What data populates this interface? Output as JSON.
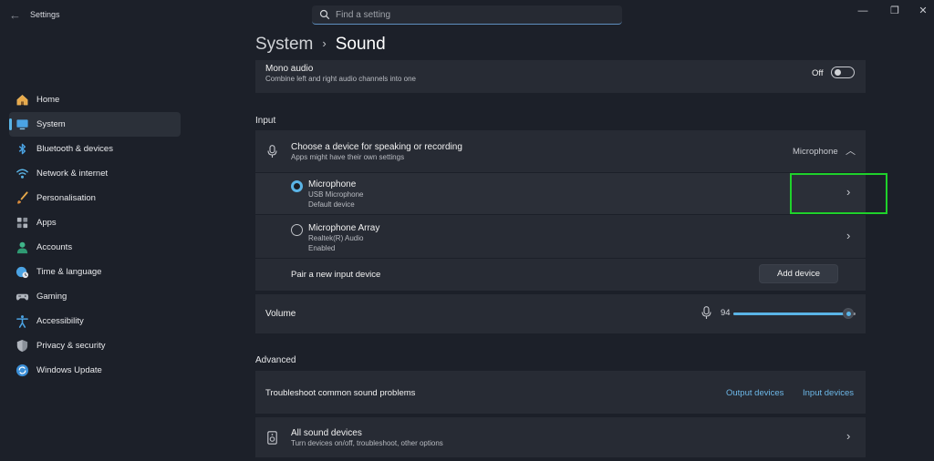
{
  "window": {
    "title": "Settings",
    "controls": {
      "minimize": "—",
      "restore": "❐",
      "close": "✕"
    }
  },
  "search": {
    "placeholder": "Find a setting"
  },
  "breadcrumb": {
    "parent": "System",
    "separator": "›",
    "current": "Sound"
  },
  "sidebar": {
    "items": [
      {
        "label": "Home",
        "icon": "home-icon"
      },
      {
        "label": "System",
        "icon": "system-icon",
        "active": true
      },
      {
        "label": "Bluetooth & devices",
        "icon": "bluetooth-icon"
      },
      {
        "label": "Network & internet",
        "icon": "wifi-icon"
      },
      {
        "label": "Personalisation",
        "icon": "brush-icon"
      },
      {
        "label": "Apps",
        "icon": "apps-icon"
      },
      {
        "label": "Accounts",
        "icon": "person-icon"
      },
      {
        "label": "Time & language",
        "icon": "globe-clock-icon"
      },
      {
        "label": "Gaming",
        "icon": "gamepad-icon"
      },
      {
        "label": "Accessibility",
        "icon": "accessibility-icon"
      },
      {
        "label": "Privacy & security",
        "icon": "shield-icon"
      },
      {
        "label": "Windows Update",
        "icon": "update-icon"
      }
    ]
  },
  "mono_audio": {
    "title": "Mono audio",
    "subtitle": "Combine left and right audio channels into one",
    "state": "Off"
  },
  "input": {
    "header": "Input",
    "chooser": {
      "title": "Choose a device for speaking or recording",
      "subtitle": "Apps might have their own settings",
      "selected": "Microphone"
    },
    "devices": [
      {
        "name": "Microphone",
        "detail": "USB Microphone",
        "status": "Default device",
        "selected": true
      },
      {
        "name": "Microphone Array",
        "detail": "Realtek(R) Audio",
        "status": "Enabled",
        "selected": false
      }
    ],
    "pair": {
      "label": "Pair a new input device",
      "button": "Add device"
    },
    "volume": {
      "label": "Volume",
      "value": "94",
      "level": 0.94
    }
  },
  "advanced": {
    "header": "Advanced",
    "troubleshoot": {
      "label": "Troubleshoot common sound problems",
      "links": [
        "Output devices",
        "Input devices"
      ]
    },
    "all_devices": {
      "title": "All sound devices",
      "subtitle": "Turn devices on/off, troubleshoot, other options"
    }
  },
  "colors": {
    "accent": "#5ab4e6",
    "highlight": "#1fd12b",
    "background": "#1c2029",
    "card": "#272b34"
  }
}
